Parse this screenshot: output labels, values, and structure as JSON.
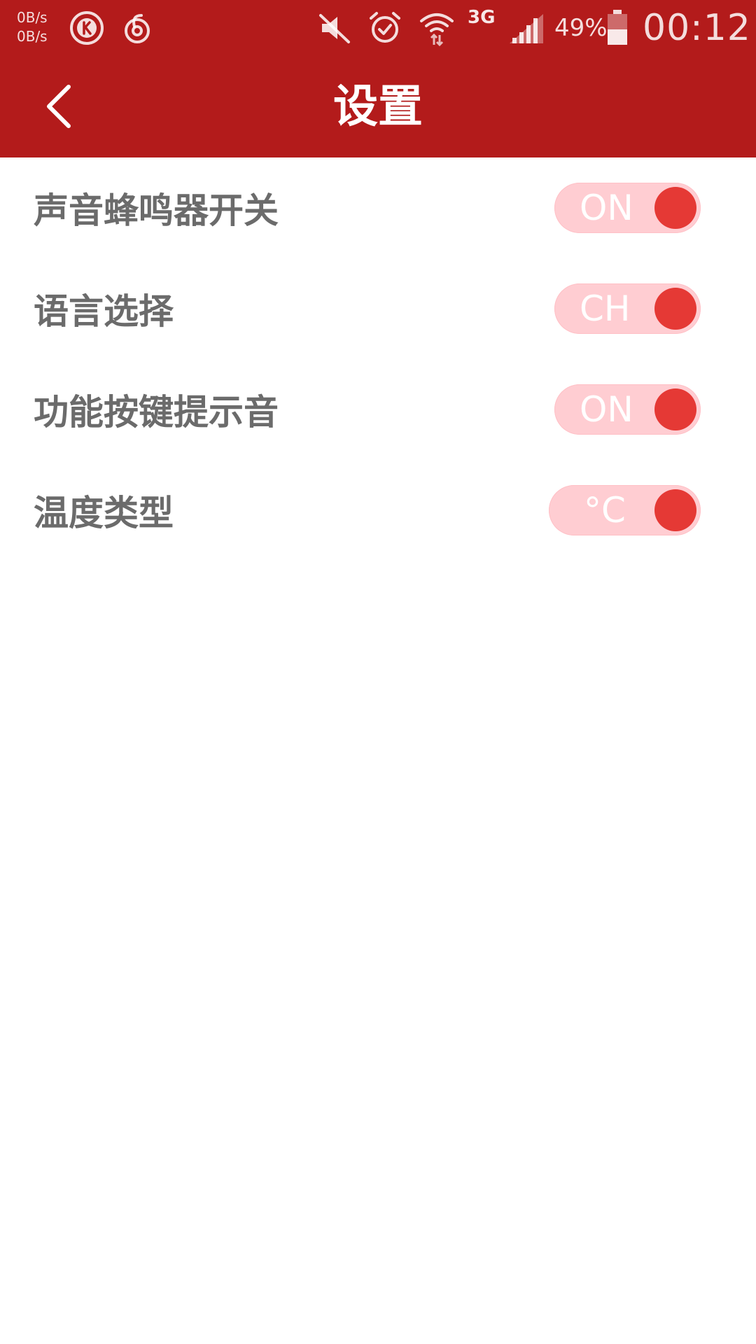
{
  "status_bar": {
    "net_speed_up": "0B/s",
    "net_speed_down": "0B/s",
    "network_type": "3G",
    "battery_percent": "49%",
    "time": "00:12",
    "icons": [
      "k-app-icon",
      "netease-music-icon",
      "mute-icon",
      "alarm-icon",
      "wifi-icon",
      "signal-icon",
      "battery-icon"
    ]
  },
  "header": {
    "title": "设置",
    "back_icon": "chevron-left-icon"
  },
  "settings": {
    "items": [
      {
        "label": "声音蜂鸣器开关",
        "toggle_text": "ON"
      },
      {
        "label": "语言选择",
        "toggle_text": "CH"
      },
      {
        "label": "功能按键提示音",
        "toggle_text": "ON"
      },
      {
        "label": "温度类型",
        "toggle_text": "°C"
      }
    ]
  },
  "colors": {
    "primary": "#b31b1b",
    "toggle_track": "#ffcdd2",
    "toggle_knob": "#e53935",
    "label_text": "#6b6b6b",
    "background": "#ffffff"
  }
}
